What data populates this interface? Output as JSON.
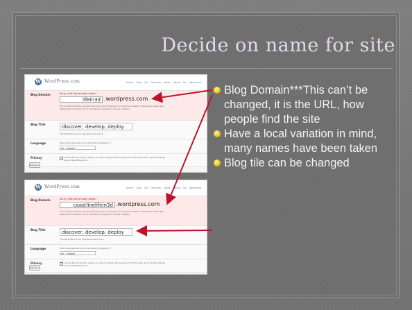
{
  "slide": {
    "title": "Decide on name for site"
  },
  "screenshot": {
    "logo_text": "WordPress.com",
    "nav": "Home  Sign Up  Features  News  About Us  Advanced",
    "labels": {
      "blog_domain": "Blog Domain",
      "blog_title": "Blog Title",
      "language": "Language",
      "privacy": "Privacy"
    },
    "sorry_text": "Sorry, that site already exists!",
    "domain_suffix": ".wordpress.com",
    "domain_help": "Once address will be domains and blog. Don't change it. It must be at least 4 characters, lowercase letters and numbers only. It cannot be changed so choose carefully",
    "title_help": "The blog title can be changed at any time.",
    "language_help": "What language will you be primarily blogging in?",
    "language_value": "en - English",
    "privacy_help": "I would like my blog to appear in search engines like Google and Technorati, and in public listings around WordPress.com.",
    "signup_button": "Signup »",
    "first": {
      "domain_value": "lifein3d",
      "title_value": "discover, develop, deploy"
    },
    "second": {
      "domain_value": "coastlinelifein3d",
      "title_value": "discover, develop, deploy"
    }
  },
  "bullets": [
    "Blog Domain***This can’t be changed, it is the URL, how people find the site",
    "Have a local variation in mind, many names have been taken",
    "Blog tile can be changed"
  ],
  "colors": {
    "title": "#e7d8ec",
    "bullet_text": "#f4f4f4",
    "bullet_mark": "#e6b800",
    "arrow": "#c0102a",
    "domain_row": "#fde9e7"
  }
}
